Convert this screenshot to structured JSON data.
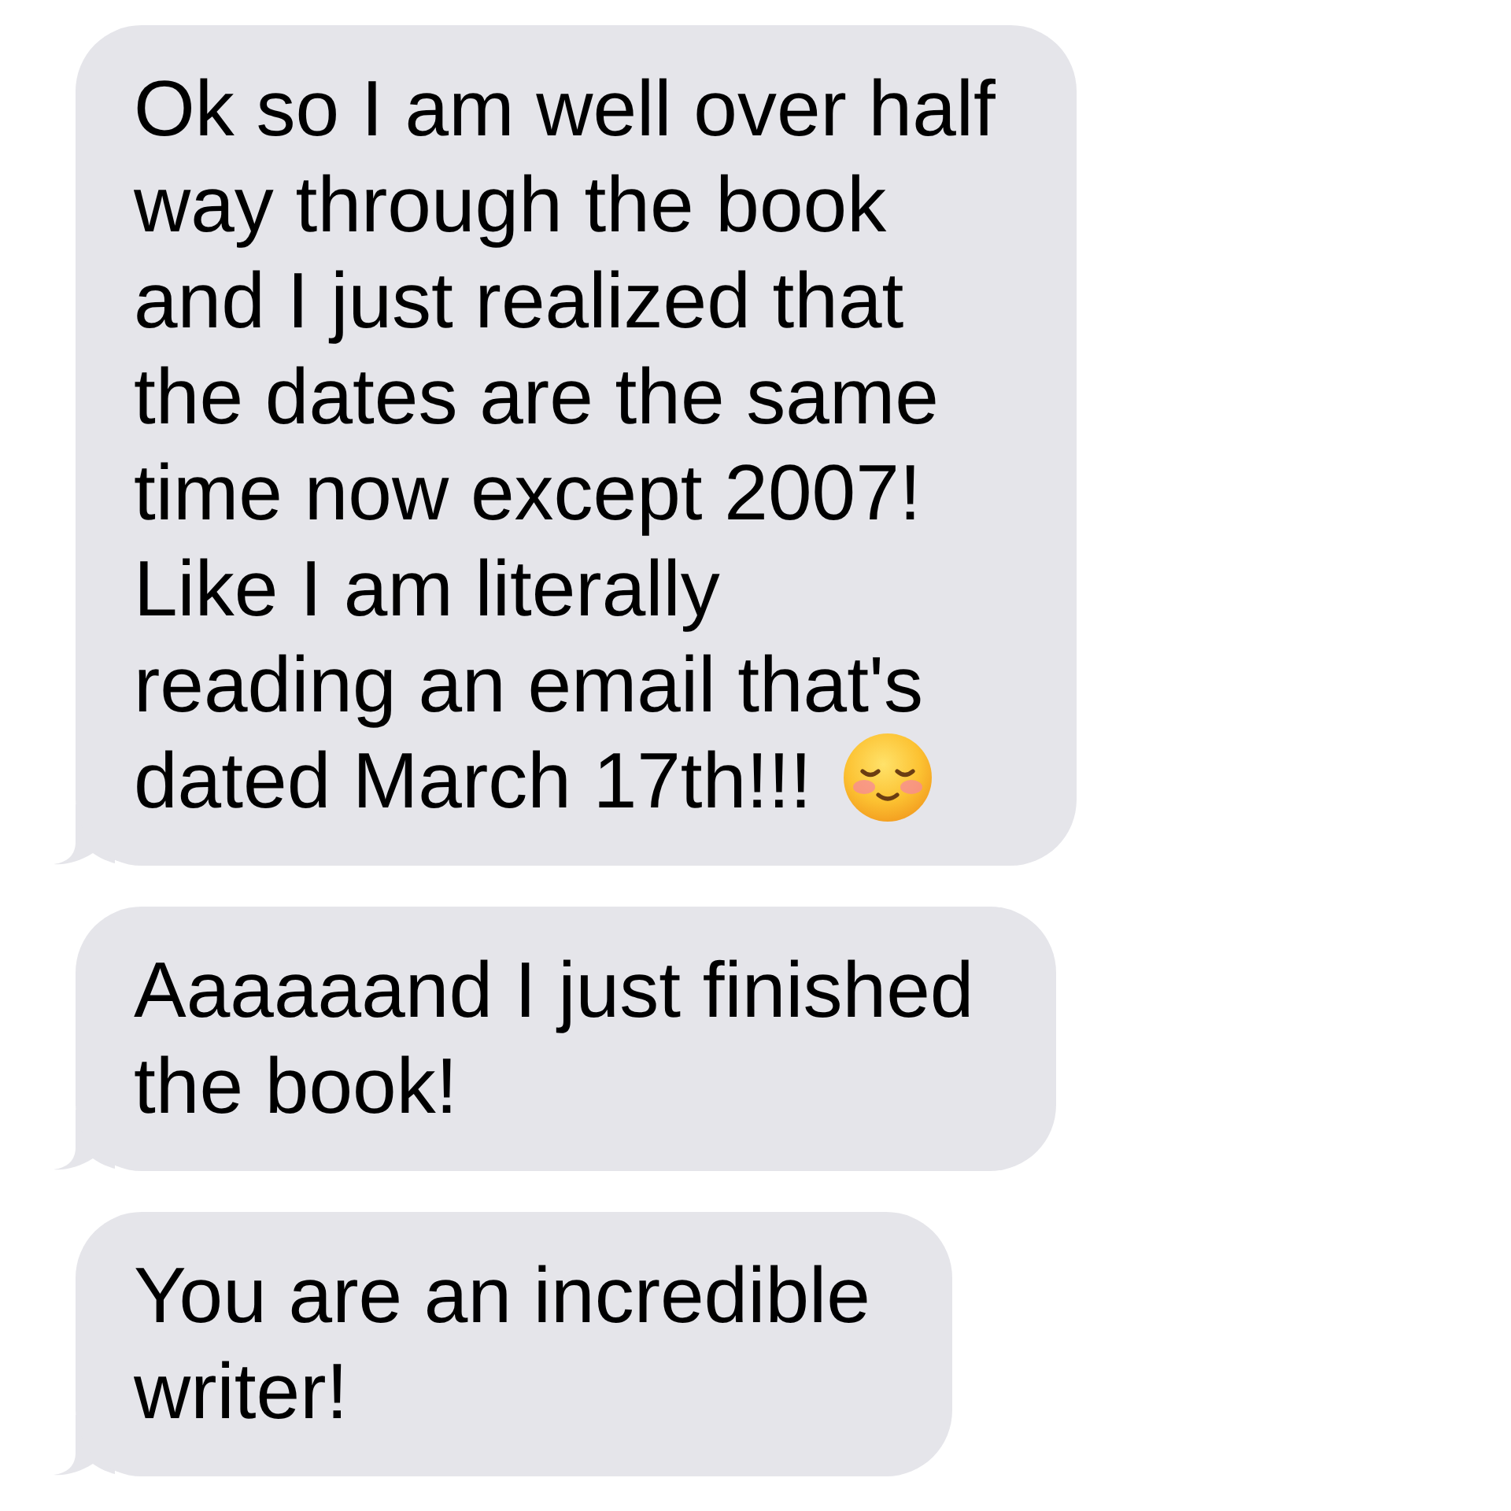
{
  "messages": [
    {
      "lines": [
        "Ok so I am well over half",
        "way through the book",
        "and I just realized that",
        "the dates are the same",
        "time now except 2007!",
        "Like I am literally",
        "reading an email that's",
        "dated March 17th!!!"
      ],
      "trailing_emoji": true
    },
    {
      "lines": [
        "Aaaaaand I just finished",
        "the book!"
      ],
      "trailing_emoji": false
    },
    {
      "lines": [
        "You are an incredible",
        "writer!"
      ],
      "trailing_emoji": false
    }
  ]
}
